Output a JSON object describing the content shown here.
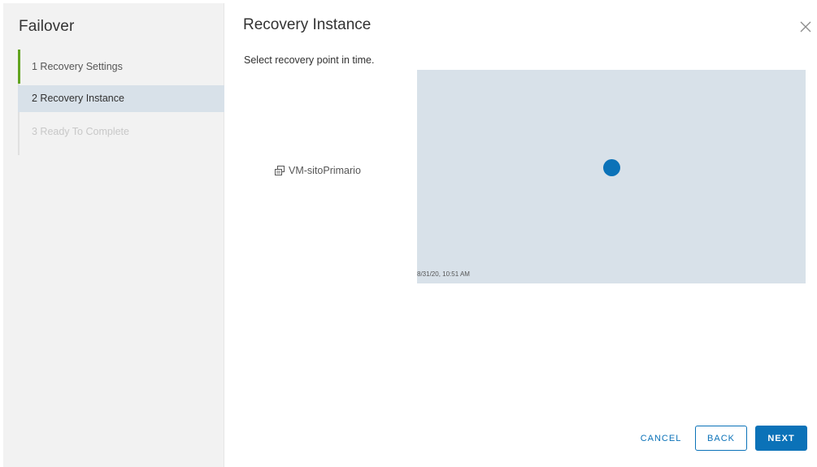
{
  "wizard": {
    "title": "Failover",
    "steps": [
      {
        "label": "1  Recovery Settings",
        "state": "complete"
      },
      {
        "label": "2  Recovery Instance",
        "state": "active"
      },
      {
        "label": "3  Ready To Complete",
        "state": "disabled"
      }
    ]
  },
  "content": {
    "title": "Recovery Instance",
    "instruction": "Select recovery point in time.",
    "vm_name": "VM-sitoPrimario",
    "vm_icon": "vm-icon",
    "timeline_label": "8/31/20, 10:51 AM",
    "recovery_point_count": 1
  },
  "footer": {
    "cancel_label": "CANCEL",
    "back_label": "BACK",
    "next_label": "NEXT"
  },
  "colors": {
    "accent": "#0b72b8",
    "step_complete": "#62a420",
    "active_step_bg": "#d8e1e9",
    "timeline_bg": "#d8e1e9",
    "sidebar_bg": "#f2f2f2"
  }
}
